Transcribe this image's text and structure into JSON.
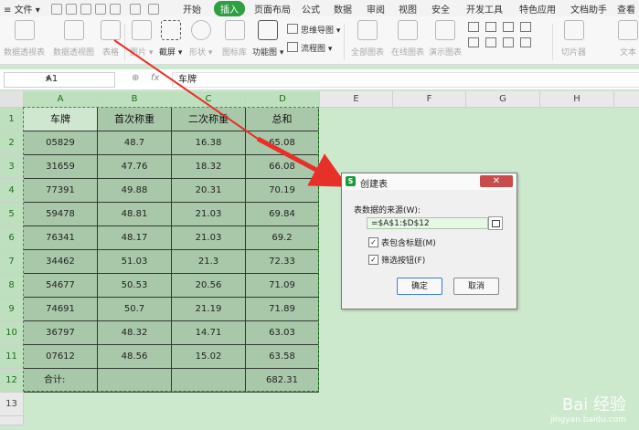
{
  "menu": {
    "items": [
      "文件",
      "开始",
      "插入",
      "页面布局",
      "公式",
      "数据",
      "审阅",
      "视图",
      "安全",
      "开发工具",
      "特色应用",
      "文档助手"
    ],
    "overflow": "查看",
    "active": "插入",
    "active_color": "#2ea043"
  },
  "ribbon": {
    "buttons": [
      "数据透视表",
      "数据透视图",
      "表格",
      "图片",
      "截屏",
      "形状",
      "图标库",
      "功能图",
      "全部图表",
      "在线图表",
      "演示图表",
      "切片器",
      "文本"
    ],
    "flow_items": [
      "思维导图",
      "流程图"
    ]
  },
  "formula_bar": {
    "cell_ref": "A1",
    "fx": "fx",
    "value": "车牌"
  },
  "sheet": {
    "columns": [
      "A",
      "B",
      "C",
      "D",
      "E",
      "F",
      "G",
      "H"
    ],
    "rows": [
      "1",
      "2",
      "3",
      "4",
      "5",
      "6",
      "7",
      "8",
      "9",
      "10",
      "11",
      "12",
      "13"
    ],
    "table": [
      [
        "车牌",
        "首次称重",
        "二次称重",
        "总和"
      ],
      [
        "05829",
        "48.7",
        "16.38",
        "65.08"
      ],
      [
        "31659",
        "47.76",
        "18.32",
        "66.08"
      ],
      [
        "77391",
        "49.88",
        "20.31",
        "70.19"
      ],
      [
        "59478",
        "48.81",
        "21.03",
        "69.84"
      ],
      [
        "76341",
        "48.17",
        "21.03",
        "69.2"
      ],
      [
        "34462",
        "51.03",
        "21.3",
        "72.33"
      ],
      [
        "54677",
        "50.53",
        "20.56",
        "71.09"
      ],
      [
        "74691",
        "50.7",
        "21.19",
        "71.89"
      ],
      [
        "36797",
        "48.32",
        "14.71",
        "63.03"
      ],
      [
        "07612",
        "48.56",
        "15.02",
        "63.58"
      ],
      [
        "合计:",
        "",
        "",
        "682.31"
      ]
    ]
  },
  "dialog": {
    "title": "创建表",
    "close": "✕",
    "source_label": "表数据的来源(W):",
    "range": "=$A$1:$D$12",
    "opt_header": "表包含标题(M)",
    "opt_header_checked": true,
    "opt_filter": "筛选按钮(F)",
    "opt_filter_checked": true,
    "ok": "确定",
    "cancel": "取消"
  },
  "watermark": {
    "text": "Bai 经验",
    "url": "jingyan.baidu.com"
  },
  "colors": {
    "sheet_bg": "#cde9cd",
    "table_bg": "#a9c8a9",
    "arrow": "#e8302a"
  }
}
